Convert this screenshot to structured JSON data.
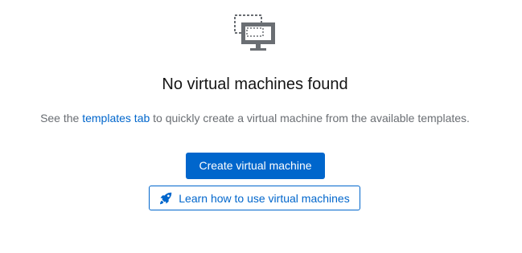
{
  "empty_state": {
    "icon": "virtual-machine-icon",
    "title": "No virtual machines found",
    "body_prefix": "See the ",
    "body_link": "templates tab",
    "body_suffix": " to quickly create a virtual machine from the available templates.",
    "primary_button_label": "Create virtual machine",
    "secondary_button_icon": "rocket-icon",
    "secondary_button_label": "Learn how to use virtual machines"
  },
  "colors": {
    "accent": "#0066cc",
    "title_text": "#151515",
    "body_text": "#6a6e73",
    "icon": "#6a6e73"
  }
}
